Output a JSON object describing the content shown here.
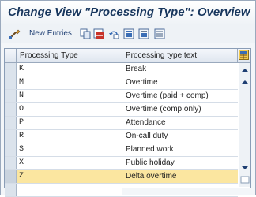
{
  "window": {
    "title": "Change View \"Processing Type\": Overview"
  },
  "toolbar": {
    "new_entries_label": "New Entries"
  },
  "table": {
    "columns": [
      "Processing Type",
      "Processing type text"
    ],
    "rows": [
      {
        "code": "K",
        "text": "Break"
      },
      {
        "code": "M",
        "text": "Overtime"
      },
      {
        "code": "N",
        "text": "Overtime (paid + comp)"
      },
      {
        "code": "O",
        "text": "Overtime (comp only)"
      },
      {
        "code": "P",
        "text": "Attendance"
      },
      {
        "code": "R",
        "text": "On-call duty"
      },
      {
        "code": "S",
        "text": "Planned work"
      },
      {
        "code": "X",
        "text": "Public holiday"
      },
      {
        "code": "Z",
        "text": "Delta overtime"
      },
      {
        "code": "",
        "text": ""
      }
    ]
  },
  "colors": {
    "title": "#17365d",
    "active_row": "#fbe6a0",
    "border": "#8a9db6"
  }
}
